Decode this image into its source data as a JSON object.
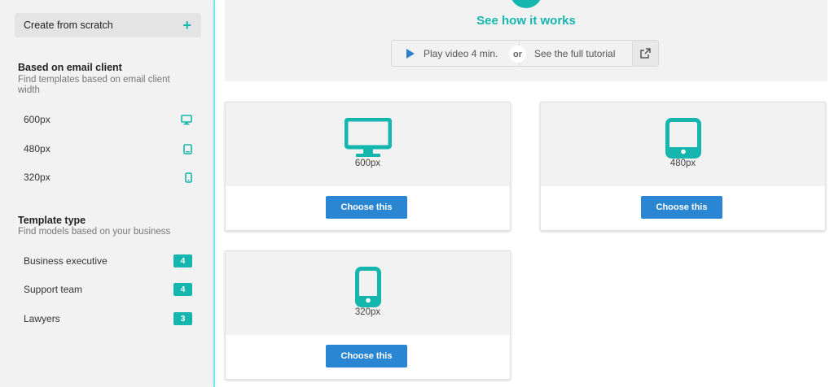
{
  "sidebar": {
    "create_label": "Create from scratch",
    "email_section": {
      "title": "Based on email client",
      "subtitle": "Find templates based on email client width",
      "items": [
        {
          "label": "600px",
          "icon": "desktop-icon"
        },
        {
          "label": "480px",
          "icon": "tablet-icon"
        },
        {
          "label": "320px",
          "icon": "phone-icon"
        }
      ]
    },
    "type_section": {
      "title": "Template type",
      "subtitle": "Find models based on your business",
      "items": [
        {
          "label": "Business executive",
          "count": "4"
        },
        {
          "label": "Support team",
          "count": "4"
        },
        {
          "label": "Lawyers",
          "count": "3"
        }
      ]
    }
  },
  "hero": {
    "title": "See how it works",
    "play_label": "Play video 4 min.",
    "or_label": "or",
    "tutorial_label": "See the full tutorial"
  },
  "cards": [
    {
      "label": "600px",
      "button": "Choose this",
      "icon": "desktop-icon"
    },
    {
      "label": "480px",
      "button": "Choose this",
      "icon": "tablet-icon"
    },
    {
      "label": "320px",
      "button": "Choose this",
      "icon": "phone-icon"
    }
  ],
  "colors": {
    "accent": "#14b6ad",
    "button": "#2a86d2",
    "sidebar_bg": "#f2f2f2"
  }
}
